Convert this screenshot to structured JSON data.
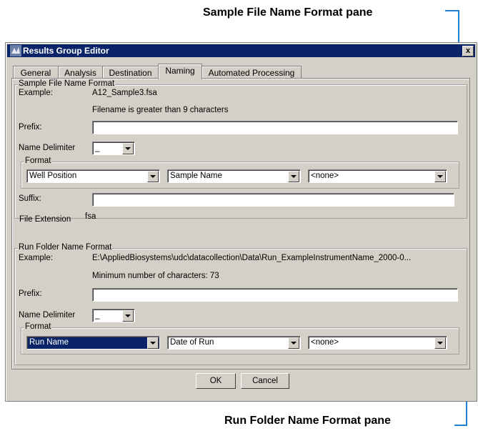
{
  "callouts": {
    "sample_pane": "Sample File Name Format pane",
    "run_pane": "Run Folder Name Format pane"
  },
  "window": {
    "title": "Results Group Editor",
    "close": "x"
  },
  "tabs": [
    {
      "label": "General"
    },
    {
      "label": "Analysis"
    },
    {
      "label": "Destination"
    },
    {
      "label": "Naming"
    },
    {
      "label": "Automated Processing"
    }
  ],
  "sample": {
    "legend": "Sample File Name Format",
    "example_label": "Example:",
    "example_value": "A12_Sample3.fsa",
    "note": "Filename is greater than 9 characters",
    "prefix_label": "Prefix:",
    "prefix_value": "",
    "delimiter_label": "Name Delimiter",
    "delimiter_value": "_",
    "format_legend": "Format",
    "format1": "Well Position",
    "format2": "Sample Name",
    "format3": "<none>",
    "suffix_label": "Suffix:",
    "suffix_value": "",
    "ext_label": "File Extension",
    "ext_value": "fsa"
  },
  "run": {
    "legend": "Run Folder Name Format",
    "example_label": "Example:",
    "example_value": "E:\\AppliedBiosystems\\udc\\datacollection\\Data\\Run_ExampleInstrumentName_2000-0...",
    "note": "Minimum number of characters: 73",
    "prefix_label": "Prefix:",
    "prefix_value": "",
    "delimiter_label": "Name Delimiter",
    "delimiter_value": "_",
    "format_legend": "Format",
    "format1": "Run Name",
    "format2": "Date of Run",
    "format3": "<none>"
  },
  "buttons": {
    "ok": "OK",
    "cancel": "Cancel"
  },
  "colors": {
    "accent_line": "#1f7fd1",
    "titlebar": "#0a246a",
    "dialog_bg": "#d4d0c8"
  }
}
